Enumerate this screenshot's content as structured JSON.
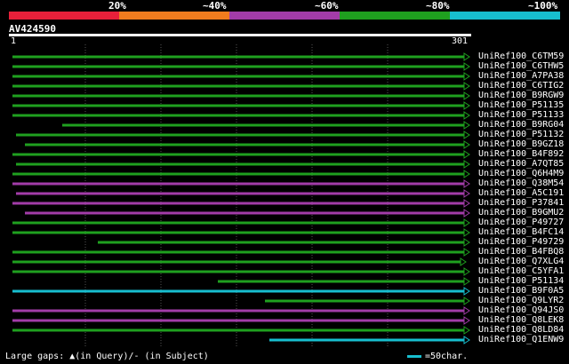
{
  "legend": {
    "labels": [
      "20%",
      "~40%",
      "~60%",
      "~80%",
      "~100%"
    ],
    "colors": [
      "#e8203a",
      "#f07c1e",
      "#a23ca8",
      "#1fa01f",
      "#17becf"
    ]
  },
  "query": {
    "name": "AV424590",
    "start": "1",
    "end": "301"
  },
  "footer": {
    "gaps": "Large gaps: ▲(in Query)/- (in Subject)",
    "scale": "=50char."
  },
  "hits": [
    {
      "label": "UniRef100_C6TM59",
      "color": "#1fa01f"
    },
    {
      "label": "UniRef100_C6THW5",
      "color": "#1fa01f"
    },
    {
      "label": "UniRef100_A7PA38",
      "color": "#1fa01f"
    },
    {
      "label": "UniRef100_C6TIG2",
      "color": "#1fa01f"
    },
    {
      "label": "UniRef100_B9RGW9",
      "color": "#1fa01f"
    },
    {
      "label": "UniRef100_P51135",
      "color": "#1fa01f"
    },
    {
      "label": "UniRef100_P51133",
      "color": "#1fa01f"
    },
    {
      "label": "UniRef100_B9RG04",
      "color": "#1fa01f"
    },
    {
      "label": "UniRef100_P51132",
      "color": "#1fa01f"
    },
    {
      "label": "UniRef100_B9GZ18",
      "color": "#1fa01f"
    },
    {
      "label": "UniRef100_B4F892",
      "color": "#1fa01f"
    },
    {
      "label": "UniRef100_A7QT85",
      "color": "#1fa01f"
    },
    {
      "label": "UniRef100_Q6H4M9",
      "color": "#1fa01f"
    },
    {
      "label": "UniRef100_Q38M54",
      "color": "#a23ca8"
    },
    {
      "label": "UniRef100_A5C191",
      "color": "#a23ca8"
    },
    {
      "label": "UniRef100_P37841",
      "color": "#a23ca8"
    },
    {
      "label": "UniRef100_B9GMU2",
      "color": "#a23ca8"
    },
    {
      "label": "UniRef100_P49727",
      "color": "#1fa01f"
    },
    {
      "label": "UniRef100_B4FC14",
      "color": "#1fa01f"
    },
    {
      "label": "UniRef100_P49729",
      "color": "#1fa01f"
    },
    {
      "label": "UniRef100_B4FBQ8",
      "color": "#1fa01f"
    },
    {
      "label": "UniRef100_Q7XLG4",
      "color": "#1fa01f"
    },
    {
      "label": "UniRef100_C5YFA1",
      "color": "#1fa01f"
    },
    {
      "label": "UniRef100_P51134",
      "color": "#1fa01f"
    },
    {
      "label": "UniRef100_B9F0A5",
      "color": "#17becf"
    },
    {
      "label": "UniRef100_Q9LYR2",
      "color": "#1fa01f"
    },
    {
      "label": "UniRef100_Q94JS0",
      "color": "#a23ca8"
    },
    {
      "label": "UniRef100_Q8LEK8",
      "color": "#a23ca8"
    },
    {
      "label": "UniRef100_Q8LD84",
      "color": "#1fa01f"
    },
    {
      "label": "UniRef100_Q1ENW9",
      "color": "#17becf"
    }
  ]
}
